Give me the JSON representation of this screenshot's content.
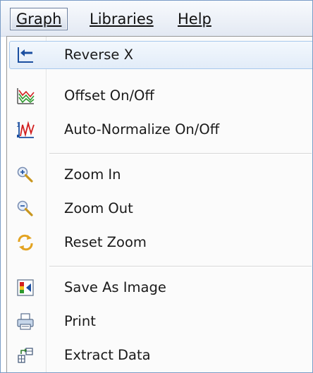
{
  "menubar": {
    "graph": "Graph",
    "libraries": "Libraries",
    "help": "Help"
  },
  "menu": {
    "items": [
      {
        "label": "Reverse X",
        "icon": "reverse-x-icon"
      },
      {
        "label": "Offset On/Off",
        "icon": "offset-icon"
      },
      {
        "label": "Auto-Normalize On/Off",
        "icon": "auto-normalize-icon"
      },
      {
        "label": "Zoom In",
        "icon": "zoom-in-icon"
      },
      {
        "label": "Zoom Out",
        "icon": "zoom-out-icon"
      },
      {
        "label": "Reset Zoom",
        "icon": "reset-zoom-icon"
      },
      {
        "label": "Save As Image",
        "icon": "save-image-icon"
      },
      {
        "label": "Print",
        "icon": "print-icon"
      },
      {
        "label": "Extract Data",
        "icon": "extract-data-icon"
      }
    ]
  },
  "colors": {
    "hover_border": "#a8c8ec",
    "menubar_active_border": "#6b7f9e",
    "icon_blue": "#1b4fa0",
    "icon_green": "#2e9a2e",
    "icon_red": "#d21f1f"
  }
}
